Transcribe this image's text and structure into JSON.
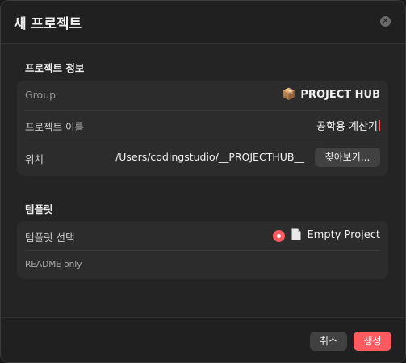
{
  "dialog": {
    "title": "새 프로젝트"
  },
  "project_info": {
    "section_title": "프로젝트 정보",
    "group_label": "Group",
    "group_icon": "package-icon",
    "group_value": "PROJECT HUB",
    "name_label": "프로젝트 이름",
    "name_value": "공학용 계산기",
    "location_label": "위치",
    "location_value": "/Users/codingstudio/__PROJECTHUB__",
    "browse_label": "찾아보기..."
  },
  "template": {
    "section_title": "템플릿",
    "select_label": "템플릿 선택",
    "selected_template": "Empty Project",
    "caption": "README only"
  },
  "footer": {
    "cancel_label": "취소",
    "create_label": "생성"
  },
  "colors": {
    "accent": "#ff5a5f",
    "background": "#202020",
    "card": "#2c2c2c"
  }
}
